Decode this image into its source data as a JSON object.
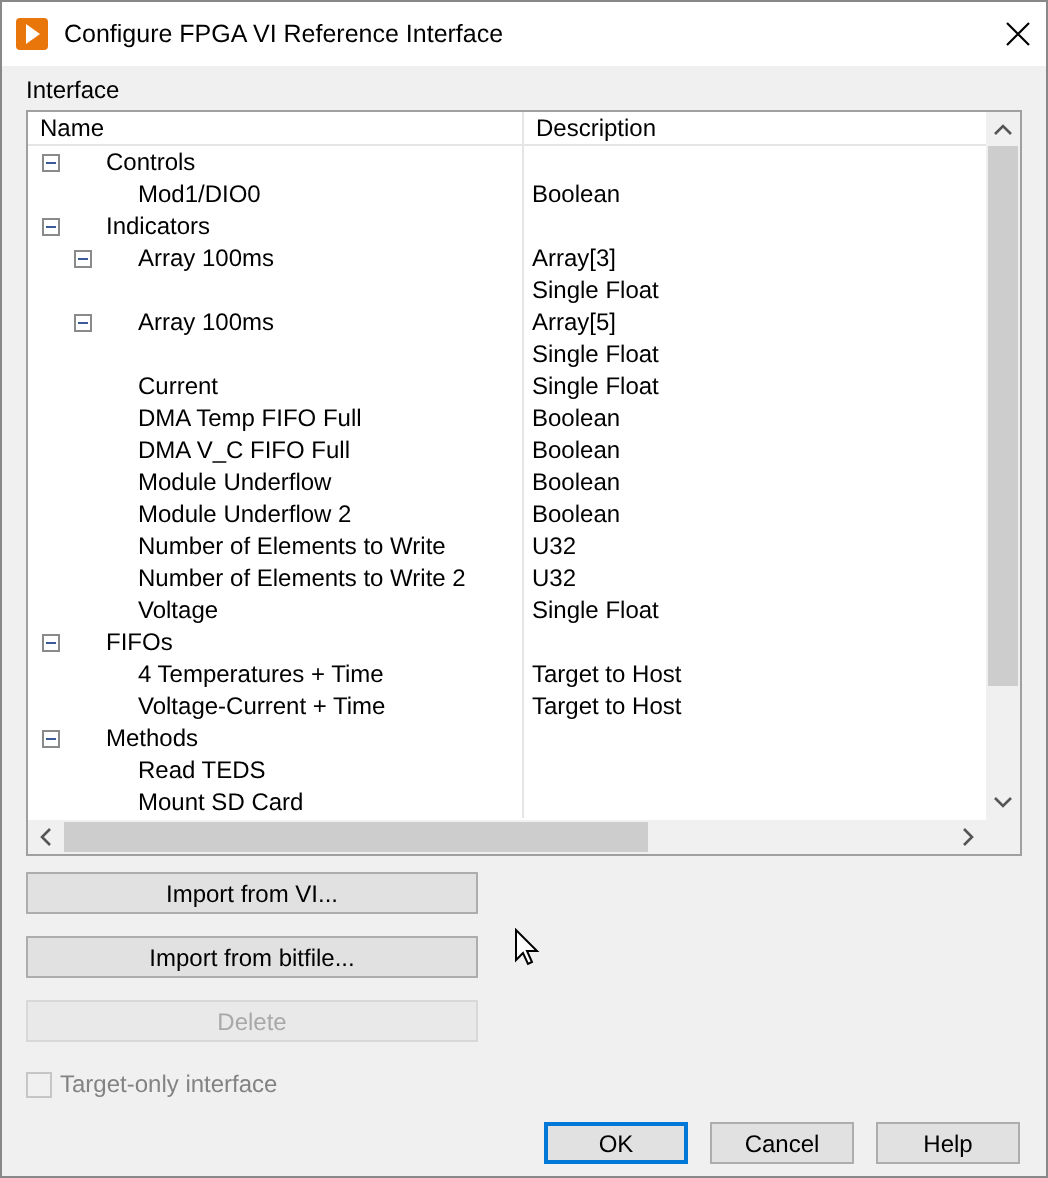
{
  "window": {
    "title": "Configure FPGA VI Reference Interface"
  },
  "interface": {
    "label": "Interface",
    "columns": [
      "Name",
      "Description"
    ],
    "items": [
      {
        "name": "Controls",
        "expanded": true,
        "children": [
          {
            "name": "Mod1/DIO0",
            "description": "Boolean"
          }
        ]
      },
      {
        "name": "Indicators",
        "expanded": true,
        "children": [
          {
            "name": "Array 100ms",
            "description": "Array[3]",
            "expanded": true,
            "children": [
              {
                "description": "Single Float"
              }
            ]
          },
          {
            "name": "Array 100ms",
            "description": "Array[5]",
            "expanded": true,
            "children": [
              {
                "description": "Single Float"
              }
            ]
          },
          {
            "name": "Current",
            "description": "Single Float"
          },
          {
            "name": "DMA Temp FIFO Full",
            "description": "Boolean"
          },
          {
            "name": "DMA V_C FIFO Full",
            "description": "Boolean"
          },
          {
            "name": "Module Underflow",
            "description": "Boolean"
          },
          {
            "name": "Module Underflow 2",
            "description": "Boolean"
          },
          {
            "name": "Number of Elements to Write",
            "description": "U32"
          },
          {
            "name": "Number of Elements to Write 2",
            "description": "U32"
          },
          {
            "name": "Voltage",
            "description": "Single Float"
          }
        ]
      },
      {
        "name": "FIFOs",
        "expanded": true,
        "children": [
          {
            "name": "4 Temperatures + Time",
            "description": "Target to Host"
          },
          {
            "name": "Voltage-Current + Time",
            "description": "Target to Host"
          }
        ]
      },
      {
        "name": "Methods",
        "expanded": true,
        "children": [
          {
            "name": "Read TEDS"
          },
          {
            "name": "Mount SD Card"
          }
        ]
      }
    ]
  },
  "buttons": [
    {
      "label": "Import from VI...",
      "disabled": false
    },
    {
      "label": "Import from bitfile...",
      "disabled": false
    },
    {
      "label": "Delete",
      "disabled": true
    }
  ],
  "target_only": {
    "label": "Target-only interface",
    "checked": false,
    "disabled": true
  },
  "dialog_buttons": [
    {
      "label": "OK",
      "default": true
    },
    {
      "label": "Cancel",
      "default": false
    },
    {
      "label": "Help",
      "default": false
    }
  ]
}
